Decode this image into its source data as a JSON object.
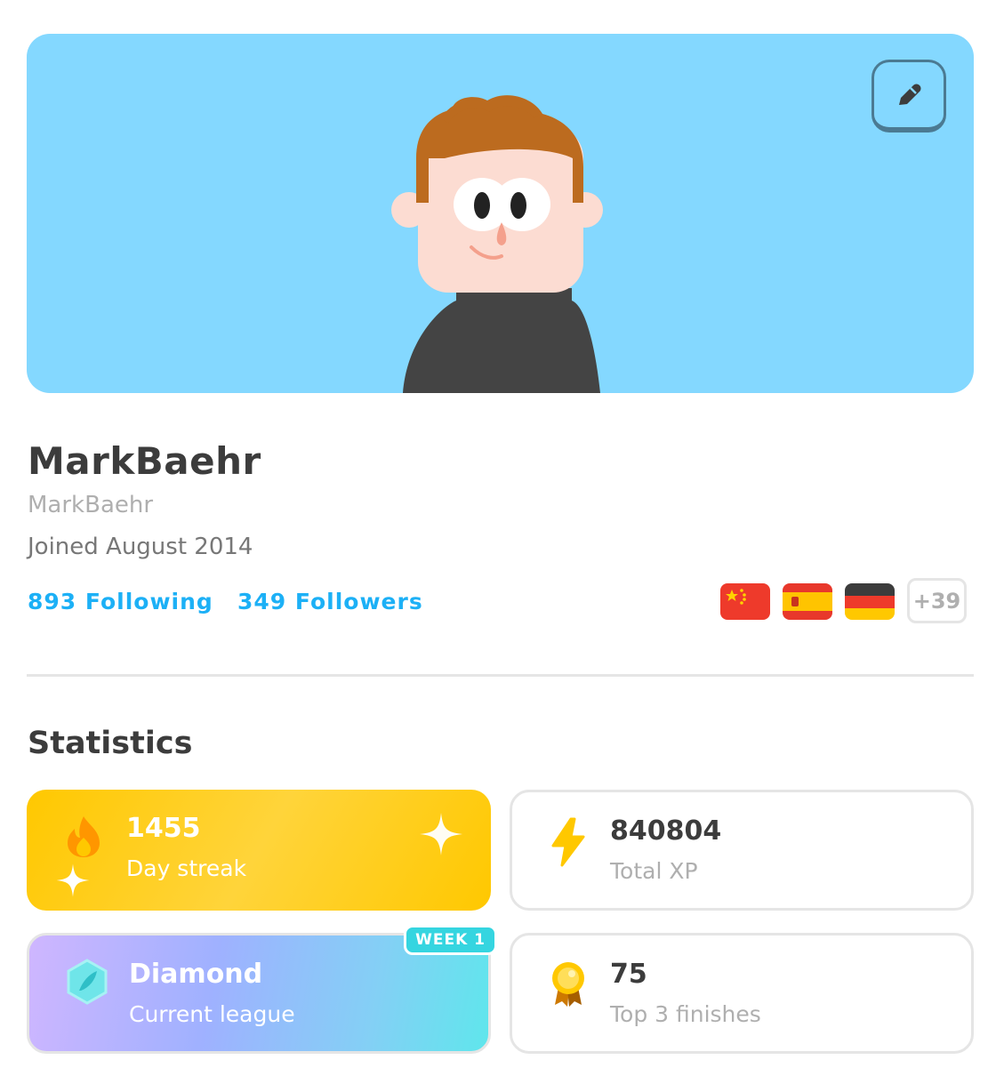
{
  "profile": {
    "display_name": "MarkBaehr",
    "username": "MarkBaehr",
    "joined": "Joined August 2014",
    "following": "893 Following",
    "followers": "349 Followers",
    "edit_icon": "pencil-icon",
    "courses": [
      {
        "flag": "china-flag-icon"
      },
      {
        "flag": "spain-flag-icon"
      },
      {
        "flag": "germany-flag-icon"
      }
    ],
    "more_courses": "+39"
  },
  "statistics": {
    "title": "Statistics",
    "cards": [
      {
        "value": "1455",
        "label": "Day streak",
        "icon": "fire-icon",
        "color": "#ffc800"
      },
      {
        "value": "840804",
        "label": "Total XP",
        "icon": "lightning-icon"
      },
      {
        "value": "Diamond",
        "label": "Current league",
        "icon": "diamond-league-icon",
        "badge": "WEEK 1"
      },
      {
        "value": "75",
        "label": "Top 3 finishes",
        "icon": "medal-icon"
      }
    ]
  },
  "colors": {
    "banner": "#84d8ff",
    "link": "#1cb0f6",
    "streak": "#ffc800"
  }
}
